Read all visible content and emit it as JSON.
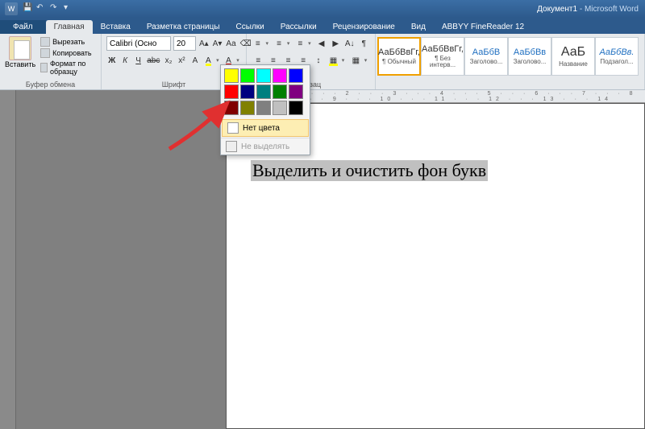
{
  "titlebar": {
    "doc": "Документ1",
    "app": "Microsoft Word"
  },
  "tabs": {
    "file": "Файл",
    "home": "Главная",
    "insert": "Вставка",
    "layout": "Разметка страницы",
    "refs": "Ссылки",
    "mail": "Рассылки",
    "review": "Рецензирование",
    "view": "Вид",
    "abbyy": "ABBYY FineReader 12"
  },
  "clipboard": {
    "paste": "Вставить",
    "cut": "Вырезать",
    "copy": "Копировать",
    "fmt": "Формат по образцу",
    "group": "Буфер обмена"
  },
  "font": {
    "name": "Calibri (Осно",
    "size": "20",
    "group": "Шрифт"
  },
  "para": {
    "group": "Абзац"
  },
  "styles": {
    "s1": {
      "prev": "АаБбВвГг,",
      "name": "¶ Обычный"
    },
    "s2": {
      "prev": "АаБбВвГг,",
      "name": "¶ Без интерв..."
    },
    "s3": {
      "prev": "АаБбВ",
      "name": "Заголово..."
    },
    "s4": {
      "prev": "АаБбВв",
      "name": "Заголово..."
    },
    "s5": {
      "prev": "АаБ",
      "name": "Название"
    },
    "s6": {
      "prev": "АаБбВв.",
      "name": "Подзагол..."
    }
  },
  "colors": {
    "row1": [
      "#ffff00",
      "#00ff00",
      "#00ffff",
      "#ff00ff",
      "#0000ff"
    ],
    "row2": [
      "#ff0000",
      "#000080",
      "#008080",
      "#008000",
      "#800080"
    ],
    "row3": [
      "#800000",
      "#808000",
      "#808080",
      "#c0c0c0",
      "#000000"
    ],
    "none": "Нет цвета",
    "stop": "Не выделять"
  },
  "document": {
    "text": "Выделить и очистить фон букв"
  },
  "ruler": "1 · · · 2 · · · 3 · · · 4 · · · 5 · · · 6 · · · 7 · · · 8 · · · 9 · · · 10 · · · 11 · · · 12 · · · 13 · · · 14"
}
